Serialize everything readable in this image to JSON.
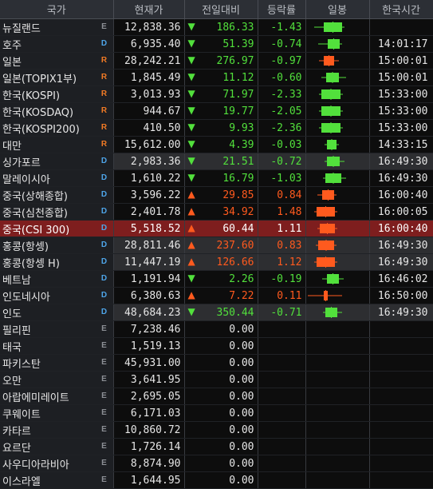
{
  "colors": {
    "up": "#ff5a1e",
    "down": "#52e03c",
    "header_bg": "#2c2f35",
    "selected_bg": "#7e1e1e"
  },
  "headers": [
    "국가",
    "현재가",
    "전일대비",
    "등락률",
    "일봉",
    "한국시간"
  ],
  "rows": [
    {
      "name": "뉴질랜드",
      "badge": "E",
      "price": "12,838.36",
      "dir": "down",
      "change": "186.33",
      "rate": "-1.43",
      "time": "",
      "alt": false,
      "selected": false,
      "candle": {
        "color": "down",
        "bodyFill": 0.85,
        "wickLow": 0.2,
        "wickHigh": 0.05,
        "pos": 0.4
      }
    },
    {
      "name": "호주",
      "badge": "D",
      "price": "6,935.40",
      "dir": "down",
      "change": "51.39",
      "rate": "-0.74",
      "time": "14:01:17",
      "alt": false,
      "selected": false,
      "candle": {
        "color": "down",
        "bodyFill": 0.55,
        "wickLow": 0.2,
        "wickHigh": 0.05,
        "pos": 0.55
      }
    },
    {
      "name": "일본",
      "badge": "R",
      "price": "28,242.21",
      "dir": "down",
      "change": "276.97",
      "rate": "-0.97",
      "time": "15:00:01",
      "alt": false,
      "selected": false,
      "candle": {
        "color": "up",
        "bodyFill": 0.5,
        "wickLow": 0.1,
        "wickHigh": 0.1,
        "pos": 0.4
      }
    },
    {
      "name": "일본(TOPIX1부)",
      "badge": "R",
      "price": "1,845.49",
      "dir": "down",
      "change": "11.12",
      "rate": "-0.60",
      "time": "15:00:01",
      "alt": false,
      "selected": false,
      "candle": {
        "color": "down",
        "bodyFill": 0.6,
        "wickLow": 0.1,
        "wickHigh": 0.15,
        "pos": 0.48
      }
    },
    {
      "name": "한국(KOSPI)",
      "badge": "R",
      "price": "3,013.93",
      "dir": "down",
      "change": "71.97",
      "rate": "-2.33",
      "time": "15:33:00",
      "alt": false,
      "selected": false,
      "candle": {
        "color": "down",
        "bodyFill": 0.9,
        "wickLow": 0.05,
        "wickHigh": 0.05,
        "pos": 0.3
      }
    },
    {
      "name": "한국(KOSDAQ)",
      "badge": "R",
      "price": "944.67",
      "dir": "down",
      "change": "19.77",
      "rate": "-2.05",
      "time": "15:33:00",
      "alt": false,
      "selected": false,
      "candle": {
        "color": "down",
        "bodyFill": 0.9,
        "wickLow": 0.05,
        "wickHigh": 0.05,
        "pos": 0.3
      }
    },
    {
      "name": "한국(KOSPI200)",
      "badge": "R",
      "price": "410.50",
      "dir": "down",
      "change": "9.93",
      "rate": "-2.36",
      "time": "15:33:00",
      "alt": false,
      "selected": false,
      "candle": {
        "color": "down",
        "bodyFill": 0.9,
        "wickLow": 0.05,
        "wickHigh": 0.05,
        "pos": 0.3
      }
    },
    {
      "name": "대만",
      "badge": "R",
      "price": "15,612.00",
      "dir": "down",
      "change": "4.39",
      "rate": "-0.03",
      "time": "14:33:15",
      "alt": false,
      "selected": false,
      "candle": {
        "color": "down",
        "bodyFill": 0.45,
        "wickLow": 0.05,
        "wickHigh": 0.05,
        "pos": 0.5
      }
    },
    {
      "name": "싱가포르",
      "badge": "D",
      "price": "2,983.36",
      "dir": "down",
      "change": "21.51",
      "rate": "-0.72",
      "time": "16:49:30",
      "alt": true,
      "selected": false,
      "candle": {
        "color": "down",
        "bodyFill": 0.6,
        "wickLow": 0.05,
        "wickHigh": 0.1,
        "pos": 0.5
      }
    },
    {
      "name": "말레이시아",
      "badge": "D",
      "price": "1,610.22",
      "dir": "down",
      "change": "16.79",
      "rate": "-1.03",
      "time": "16:49:30",
      "alt": false,
      "selected": false,
      "candle": {
        "color": "down",
        "bodyFill": 0.75,
        "wickLow": 0.05,
        "wickHigh": 0.1,
        "pos": 0.45
      }
    },
    {
      "name": "중국(상해종합)",
      "badge": "D",
      "price": "3,596.22",
      "dir": "up",
      "change": "29.85",
      "rate": "0.84",
      "time": "16:00:40",
      "alt": false,
      "selected": false,
      "candle": {
        "color": "up",
        "bodyFill": 0.55,
        "wickLow": 0.1,
        "wickHigh": 0.05,
        "pos": 0.35
      }
    },
    {
      "name": "중국(심천종합)",
      "badge": "D",
      "price": "2,401.78",
      "dir": "up",
      "change": "34.92",
      "rate": "1.48",
      "time": "16:00:05",
      "alt": false,
      "selected": false,
      "candle": {
        "color": "up",
        "bodyFill": 0.85,
        "wickLow": 0.05,
        "wickHigh": 0.05,
        "pos": 0.15
      }
    },
    {
      "name": "중국(CSI 300)",
      "badge": "D",
      "price": "5,518.52",
      "dir": "up",
      "change": "60.44",
      "rate": "1.11",
      "time": "16:00:40",
      "alt": false,
      "selected": true,
      "candle": {
        "color": "up",
        "bodyFill": 0.7,
        "wickLow": 0.05,
        "wickHigh": 0.05,
        "pos": 0.25
      }
    },
    {
      "name": "홍콩(항셍)",
      "badge": "D",
      "price": "28,811.46",
      "dir": "up",
      "change": "237.60",
      "rate": "0.83",
      "time": "16:49:30",
      "alt": true,
      "selected": false,
      "candle": {
        "color": "up",
        "bodyFill": 0.75,
        "wickLow": 0.05,
        "wickHigh": 0.05,
        "pos": 0.2
      }
    },
    {
      "name": "홍콩(항셍 H)",
      "badge": "D",
      "price": "11,447.19",
      "dir": "up",
      "change": "126.66",
      "rate": "1.12",
      "time": "16:49:30",
      "alt": true,
      "selected": false,
      "candle": {
        "color": "up",
        "bodyFill": 0.85,
        "wickLow": 0.05,
        "wickHigh": 0.05,
        "pos": 0.15
      }
    },
    {
      "name": "베트남",
      "badge": "D",
      "price": "1,191.94",
      "dir": "down",
      "change": "2.26",
      "rate": "-0.19",
      "time": "16:46:02",
      "alt": false,
      "selected": false,
      "candle": {
        "color": "down",
        "bodyFill": 0.55,
        "wickLow": 0.1,
        "wickHigh": 0.1,
        "pos": 0.5
      }
    },
    {
      "name": "인도네시아",
      "badge": "D",
      "price": "6,380.63",
      "dir": "up",
      "change": "7.22",
      "rate": "0.11",
      "time": "16:50:00",
      "alt": false,
      "selected": false,
      "candle": {
        "color": "up",
        "bodyFill": 0.2,
        "wickLow": 0.4,
        "wickHigh": 0.3,
        "pos": 0.4
      }
    },
    {
      "name": "인도",
      "badge": "D",
      "price": "48,684.23",
      "dir": "down",
      "change": "350.44",
      "rate": "-0.71",
      "time": "16:49:30",
      "alt": true,
      "selected": false,
      "candle": {
        "color": "down",
        "bodyFill": 0.55,
        "wickLow": 0.05,
        "wickHigh": 0.1,
        "pos": 0.45
      }
    },
    {
      "name": "필리핀",
      "badge": "E",
      "price": "7,238.46",
      "dir": "none",
      "change": "0.00",
      "rate": "",
      "time": "",
      "alt": false,
      "selected": false,
      "candle": null
    },
    {
      "name": "태국",
      "badge": "E",
      "price": "1,519.13",
      "dir": "none",
      "change": "0.00",
      "rate": "",
      "time": "",
      "alt": false,
      "selected": false,
      "candle": null
    },
    {
      "name": "파키스탄",
      "badge": "E",
      "price": "45,931.00",
      "dir": "none",
      "change": "0.00",
      "rate": "",
      "time": "",
      "alt": false,
      "selected": false,
      "candle": null
    },
    {
      "name": "오만",
      "badge": "E",
      "price": "3,641.95",
      "dir": "none",
      "change": "0.00",
      "rate": "",
      "time": "",
      "alt": false,
      "selected": false,
      "candle": null
    },
    {
      "name": "아랍에미레이트",
      "badge": "E",
      "price": "2,695.05",
      "dir": "none",
      "change": "0.00",
      "rate": "",
      "time": "",
      "alt": false,
      "selected": false,
      "candle": null
    },
    {
      "name": "쿠웨이트",
      "badge": "E",
      "price": "6,171.03",
      "dir": "none",
      "change": "0.00",
      "rate": "",
      "time": "",
      "alt": false,
      "selected": false,
      "candle": null
    },
    {
      "name": "카타르",
      "badge": "E",
      "price": "10,860.72",
      "dir": "none",
      "change": "0.00",
      "rate": "",
      "time": "",
      "alt": false,
      "selected": false,
      "candle": null
    },
    {
      "name": "요르단",
      "badge": "E",
      "price": "1,726.14",
      "dir": "none",
      "change": "0.00",
      "rate": "",
      "time": "",
      "alt": false,
      "selected": false,
      "candle": null
    },
    {
      "name": "사우디아라비아",
      "badge": "E",
      "price": "8,874.90",
      "dir": "none",
      "change": "0.00",
      "rate": "",
      "time": "",
      "alt": false,
      "selected": false,
      "candle": null
    },
    {
      "name": "이스라엘",
      "badge": "E",
      "price": "1,644.95",
      "dir": "none",
      "change": "0.00",
      "rate": "",
      "time": "",
      "alt": false,
      "selected": false,
      "candle": null
    }
  ]
}
